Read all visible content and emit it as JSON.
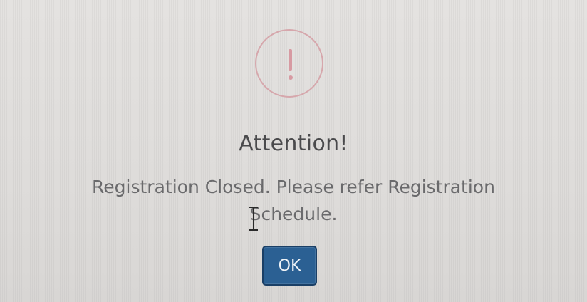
{
  "dialog": {
    "icon": "exclamation-circle-icon",
    "icon_glyph": "!",
    "title": "Attention!",
    "message": "Registration Closed. Please refer Registration Schedule.",
    "ok_label": "OK"
  },
  "colors": {
    "icon_ring": "#d6a7ac",
    "title_text": "#4a4a4c",
    "message_text": "#6a6a6c",
    "button_bg": "#2b6093"
  }
}
